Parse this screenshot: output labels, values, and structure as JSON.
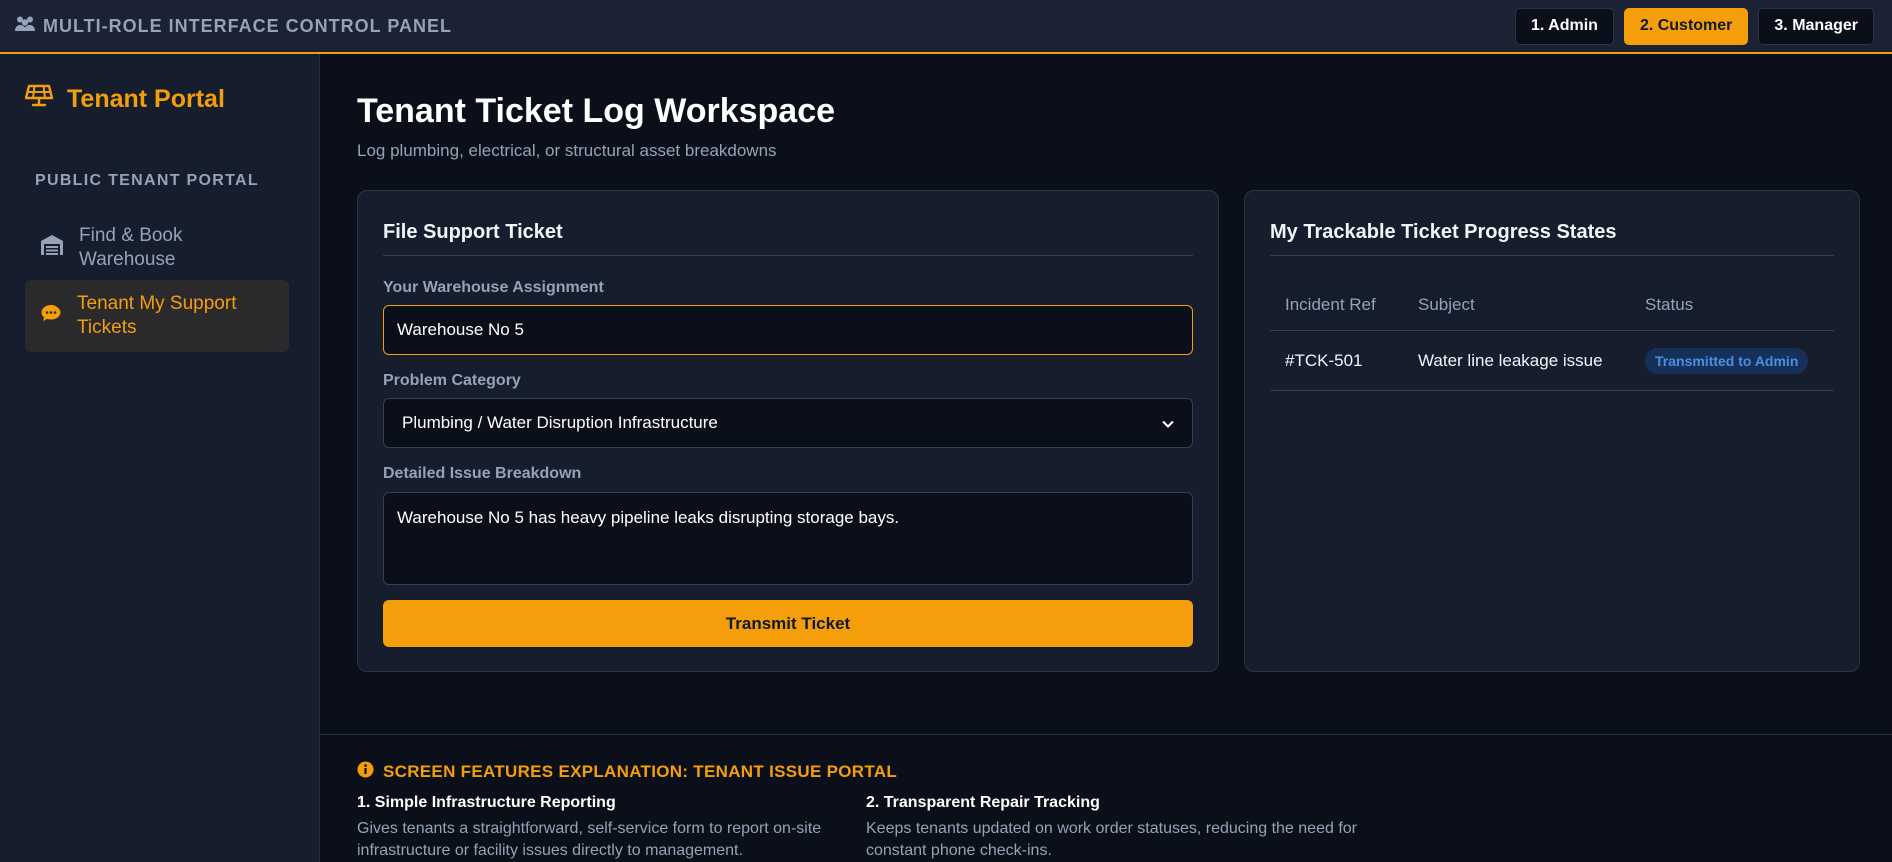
{
  "topbar": {
    "title": "MULTI-ROLE INTERFACE CONTROL PANEL",
    "title_icon": "users-icon",
    "roles": [
      {
        "label": "1. Admin",
        "active": false
      },
      {
        "label": "2. Customer",
        "active": true
      },
      {
        "label": "3. Manager",
        "active": false
      }
    ]
  },
  "sidebar": {
    "brand": "Tenant Portal",
    "brand_icon": "solar-panel-icon",
    "section_label": "PUBLIC TENANT PORTAL",
    "items": [
      {
        "label": "Find & Book Warehouse",
        "icon": "warehouse-icon",
        "active": false
      },
      {
        "label": "Tenant My Support Tickets",
        "icon": "comment-dots-icon",
        "active": true
      }
    ]
  },
  "main": {
    "title": "Tenant Ticket Log Workspace",
    "subtitle": "Log plumbing, electrical, or structural asset breakdowns"
  },
  "form": {
    "title": "File Support Ticket",
    "warehouse_label": "Your Warehouse Assignment",
    "warehouse_value": "Warehouse No 5",
    "category_label": "Problem Category",
    "category_value": "Plumbing / Water Disruption Infrastructure",
    "details_label": "Detailed Issue Breakdown",
    "details_value": "Warehouse No 5 has heavy pipeline leaks disrupting storage bays.",
    "submit_label": "Transmit Ticket"
  },
  "progress": {
    "title": "My Trackable Ticket Progress States",
    "columns": [
      "Incident Ref",
      "Subject",
      "Status"
    ],
    "rows": [
      {
        "ref": "#TCK-501",
        "subject": "Water line leakage issue",
        "status": "Transmitted to Admin"
      }
    ]
  },
  "explanation": {
    "title": "SCREEN FEATURES EXPLANATION: TENANT ISSUE PORTAL",
    "features": [
      {
        "title": "1. Simple Infrastructure Reporting",
        "description": "Gives tenants a straightforward, self-service form to report on-site infrastructure or facility issues directly to management."
      },
      {
        "title": "2. Transparent Repair Tracking",
        "description": "Keeps tenants updated on work order statuses, reducing the need for constant phone check-ins."
      }
    ]
  },
  "colors": {
    "accent": "#f59e0b",
    "background": "#0b0f19",
    "panel": "#161e2e",
    "status_badge_bg": "#17305a",
    "status_badge_text": "#4a90e2"
  }
}
